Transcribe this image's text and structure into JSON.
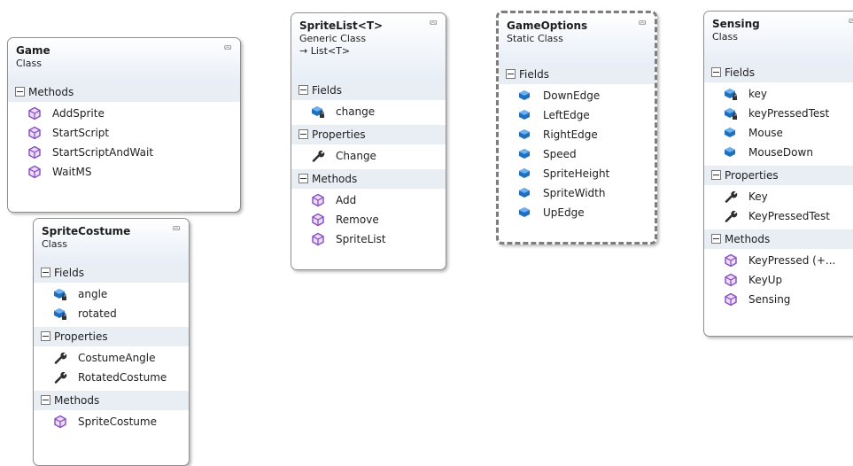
{
  "labels": {
    "fields": "Fields",
    "properties": "Properties",
    "methods": "Methods"
  },
  "game": {
    "name": "Game",
    "kind": "Class",
    "methods": [
      "AddSprite",
      "StartScript",
      "StartScriptAndWait",
      "WaitMS"
    ]
  },
  "spriteCostume": {
    "name": "SpriteCostume",
    "kind": "Class",
    "fields": [
      "angle",
      "rotated"
    ],
    "properties": [
      "CostumeAngle",
      "RotatedCostume"
    ],
    "methods": [
      "SpriteCostume"
    ]
  },
  "spriteList": {
    "name": "SpriteList<T>",
    "kind": "Generic Class",
    "inherits": "→ List<T>",
    "fields": [
      "change"
    ],
    "properties": [
      "Change"
    ],
    "methods": [
      "Add",
      "Remove",
      "SpriteList"
    ]
  },
  "gameOptions": {
    "name": "GameOptions",
    "kind": "Static Class",
    "fields": [
      "DownEdge",
      "LeftEdge",
      "RightEdge",
      "Speed",
      "SpriteHeight",
      "SpriteWidth",
      "UpEdge"
    ]
  },
  "sensing": {
    "name": "Sensing",
    "kind": "Class",
    "fields": [
      "key",
      "keyPressedTest",
      "Mouse",
      "MouseDown"
    ],
    "properties": [
      "Key",
      "KeyPressedTest"
    ],
    "methods": [
      "KeyPressed  (+...",
      "KeyUp",
      "Sensing"
    ]
  },
  "colors": {
    "method": "#8a4bbf",
    "field": "#1f6fbf",
    "property": "#2e2e2e",
    "header": "#e9eef5"
  }
}
